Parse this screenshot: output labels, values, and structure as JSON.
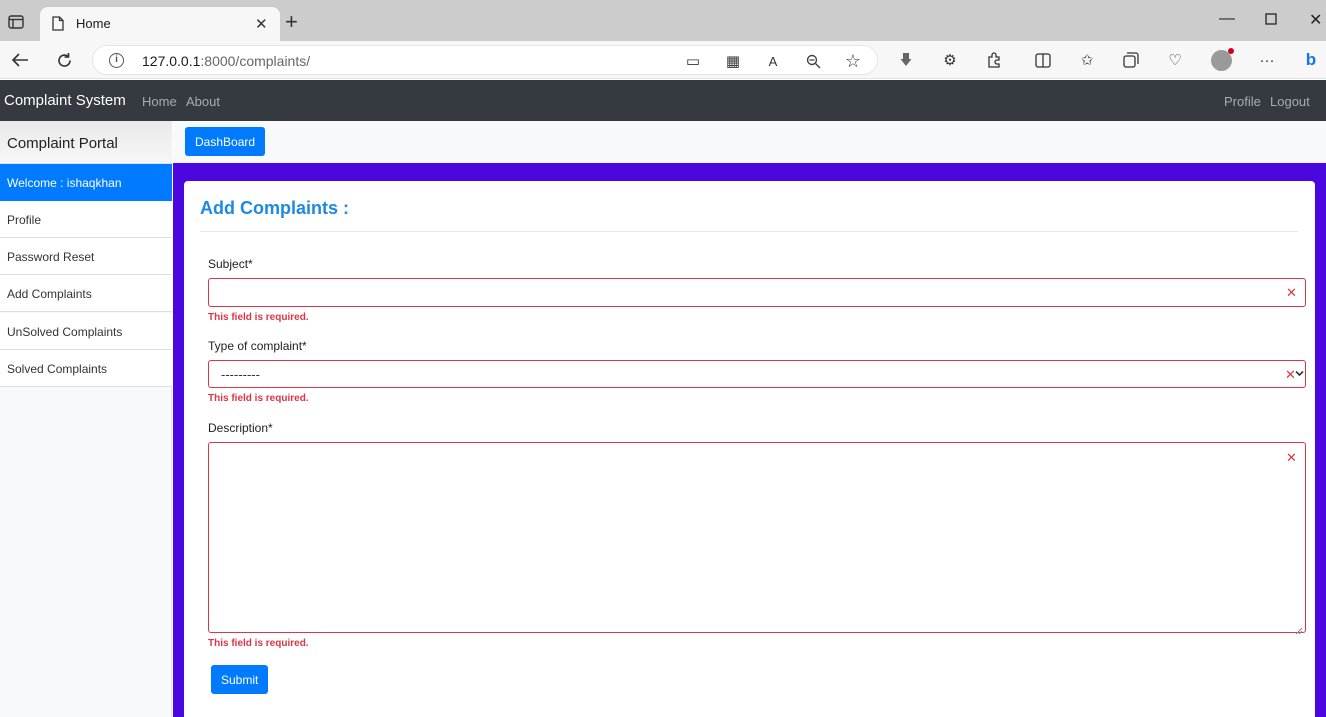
{
  "browser": {
    "tab_title": "Home",
    "url_host": "127.0.0.1",
    "url_rest": ":8000/complaints/"
  },
  "navbar": {
    "brand": "Complaint System",
    "links": [
      "Home",
      "About"
    ],
    "right_links": [
      "Profile",
      "Logout"
    ]
  },
  "sidebar": {
    "title": "Complaint Portal",
    "items": [
      {
        "label": "Welcome : ishaqkhan",
        "active": true
      },
      {
        "label": "Profile"
      },
      {
        "label": "Password Reset"
      },
      {
        "label": "Add Complaints"
      },
      {
        "label": "UnSolved Complaints"
      },
      {
        "label": "Solved Complaints"
      }
    ]
  },
  "topbar": {
    "dashboard_label": "DashBoard"
  },
  "form": {
    "title": "Add Complaints :",
    "subject_label": "Subject*",
    "subject_value": "",
    "subject_error": "This field is required.",
    "type_label": "Type of complaint*",
    "type_selected": "---------",
    "type_error": "This field is required.",
    "description_label": "Description*",
    "description_value": "",
    "description_error": "This field is required.",
    "submit_label": "Submit"
  },
  "colors": {
    "primary": "#007bff",
    "navbar_bg": "#343a40",
    "page_bg": "#4a07e0",
    "error": "#dc3545"
  }
}
